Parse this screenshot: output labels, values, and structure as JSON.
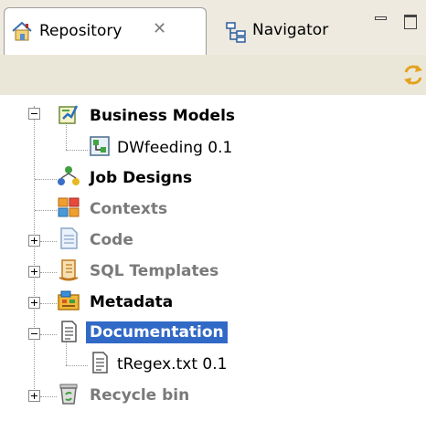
{
  "tabs": {
    "repository_label": "Repository",
    "navigator_label": "Navigator"
  },
  "colors": {
    "selection": "#3169c6",
    "tab_bar": "#eeeae0",
    "toolbar": "#ebe7d8"
  },
  "tree": {
    "business_models": {
      "label": "Business Models",
      "expanded": true
    },
    "dwfeeding": {
      "label": "DWfeeding 0.1"
    },
    "job_designs": {
      "label": "Job Designs"
    },
    "contexts": {
      "label": "Contexts"
    },
    "code": {
      "label": "Code",
      "expanded": false
    },
    "sql_templates": {
      "label": "SQL Templates",
      "expanded": false
    },
    "metadata": {
      "label": "Metadata",
      "expanded": false
    },
    "documentation": {
      "label": "Documentation",
      "expanded": true,
      "selected": true
    },
    "tregex": {
      "label": "tRegex.txt 0.1"
    },
    "recycle_bin": {
      "label": "Recycle bin",
      "expanded": false
    }
  }
}
